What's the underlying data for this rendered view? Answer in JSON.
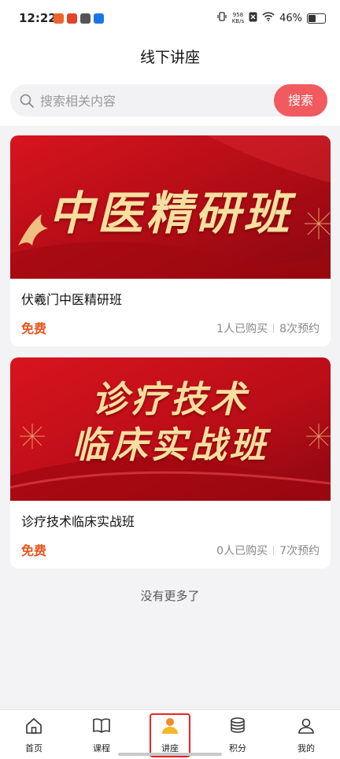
{
  "status": {
    "time": "12:22",
    "speed_top": "958",
    "speed_bottom": "KB/s",
    "battery": "46%"
  },
  "header": {
    "title": "线下讲座"
  },
  "search": {
    "placeholder": "搜索相关内容",
    "button": "搜索"
  },
  "courses": [
    {
      "banner_text": "中医精研班",
      "title": "伏羲门中医精研班",
      "price": "免费",
      "bought": "1人已购买",
      "booked": "8次预约"
    },
    {
      "banner_line1": "诊疗技术",
      "banner_line2": "临床实战班",
      "title": "诊疗技术临床实战班",
      "price": "免费",
      "bought": "0人已购买",
      "booked": "7次预约"
    }
  ],
  "footer_text": "没有更多了",
  "tabs": [
    {
      "label": "首页",
      "icon": "home-icon"
    },
    {
      "label": "课程",
      "icon": "book-icon"
    },
    {
      "label": "讲座",
      "icon": "lecturer-icon",
      "active": true
    },
    {
      "label": "积分",
      "icon": "coins-icon"
    },
    {
      "label": "我的",
      "icon": "user-icon"
    }
  ],
  "colors": {
    "accent": "#f15a5f",
    "price": "#e8551d",
    "active_outline": "#e22222",
    "banner_red": "#c4101a",
    "banner_gold": "#f7dfa0"
  }
}
